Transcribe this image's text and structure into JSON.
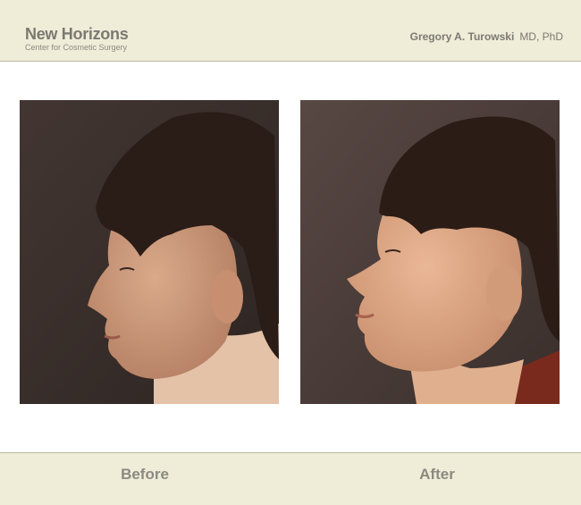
{
  "header": {
    "brand_title": "New Horizons",
    "brand_subtitle": "Center for Cosmetic Surgery",
    "doctor_name": "Gregory A. Turowski",
    "doctor_credentials": "MD, PhD"
  },
  "photos": {
    "before_caption": "Before",
    "after_caption": "After"
  },
  "colors": {
    "header_bg": "#efecd8",
    "text_gray": "#7a7a72",
    "photo_bg": "#3b302c"
  }
}
